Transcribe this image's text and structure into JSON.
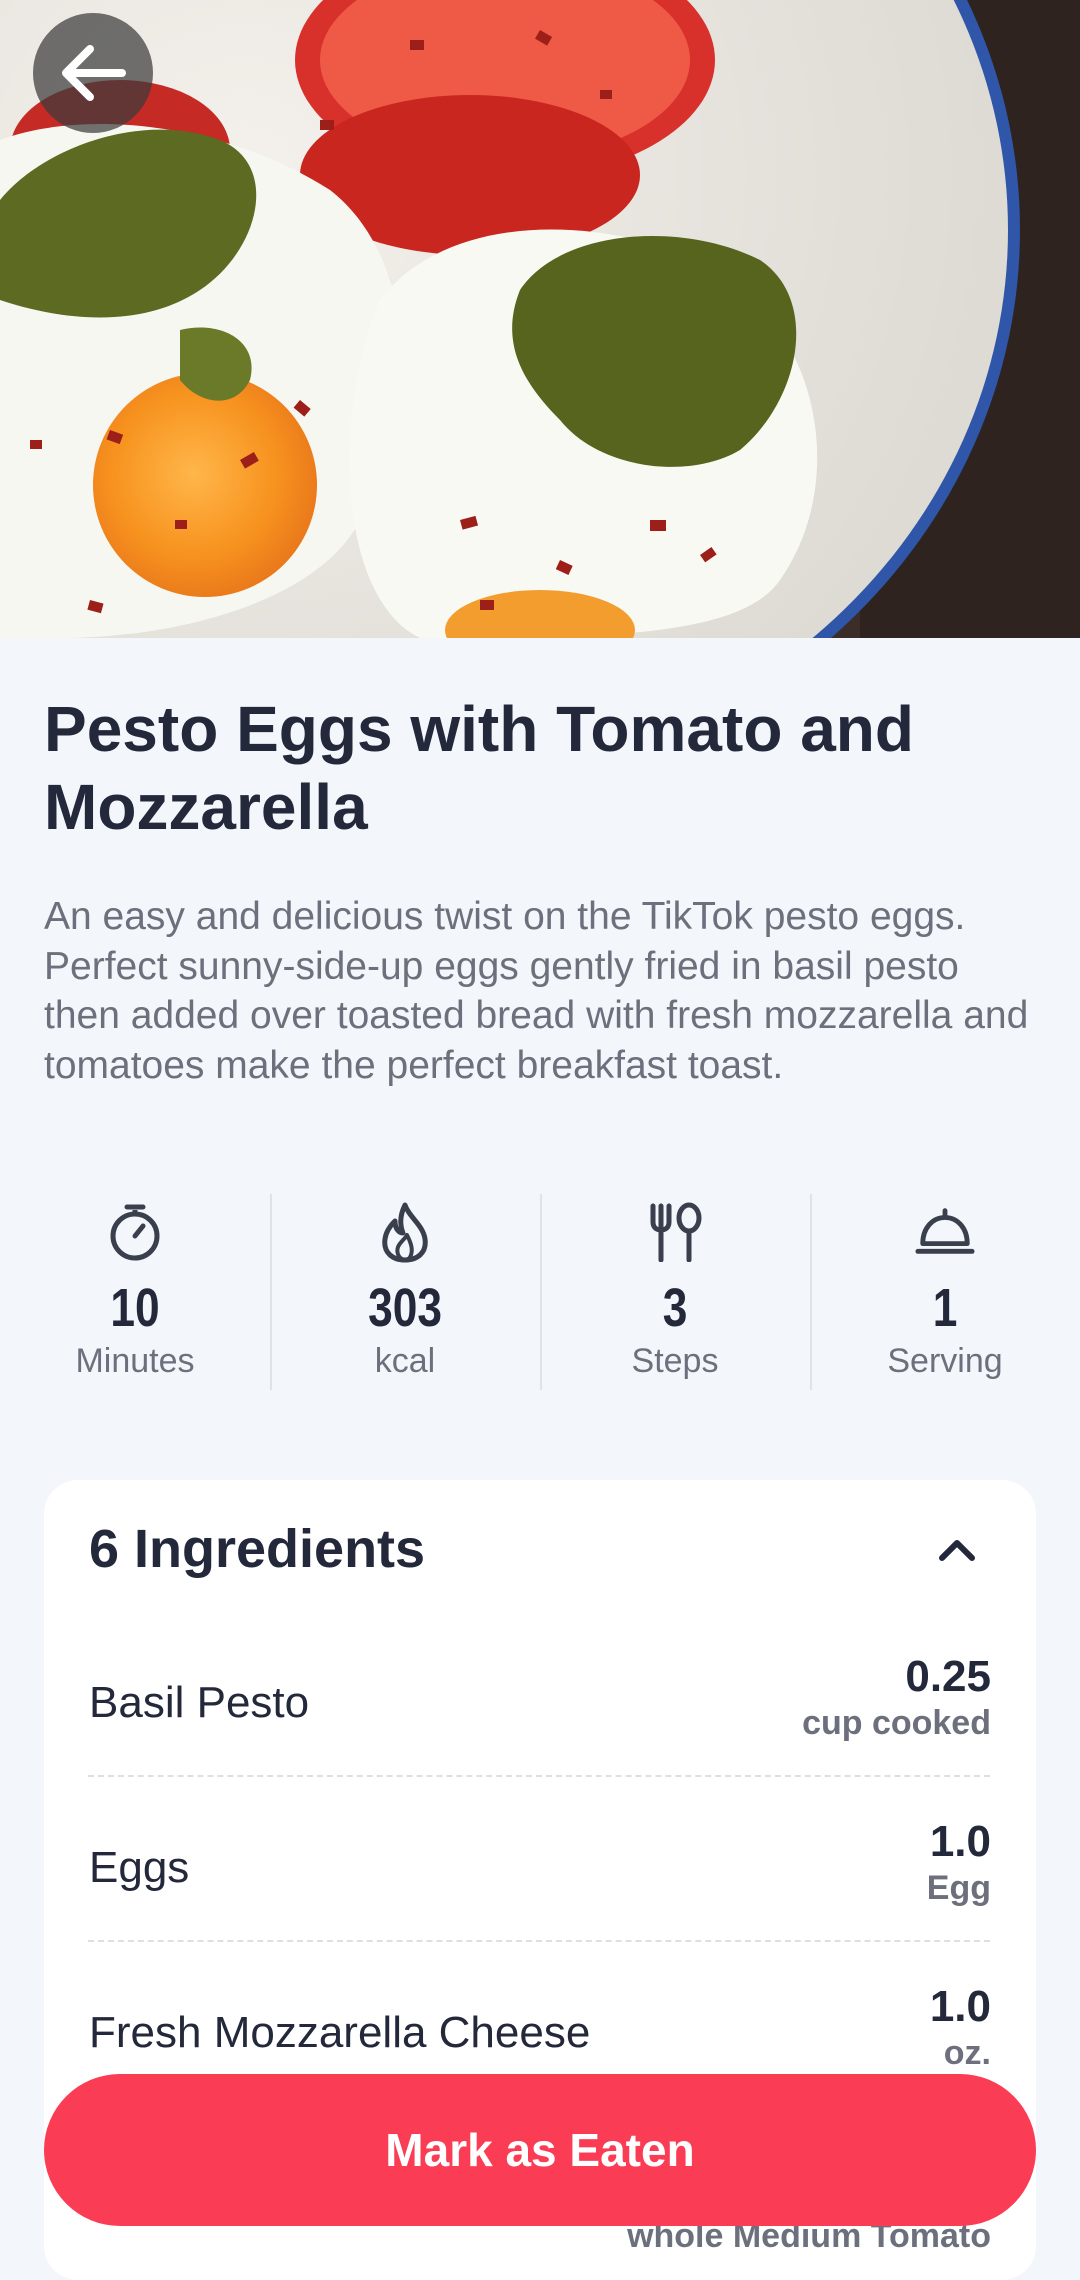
{
  "hero": {
    "icon": "food-photo-pesto-eggs",
    "back_icon": "arrow-left-icon"
  },
  "recipe": {
    "title": "Pesto Eggs with Tomato and Mozzarella",
    "description": "An easy and delicious twist on the TikTok pesto eggs. Perfect sunny-side-up eggs gently fried in basil pesto then added over toasted bread with fresh mozzarella and tomatoes make the perfect breakfast toast."
  },
  "stats": [
    {
      "icon": "stopwatch-icon",
      "value": "10",
      "label": "Minutes"
    },
    {
      "icon": "flame-icon",
      "value": "303",
      "label": "kcal"
    },
    {
      "icon": "fork-spoon-icon",
      "value": "3",
      "label": "Steps"
    },
    {
      "icon": "cloche-icon",
      "value": "1",
      "label": "Serving"
    }
  ],
  "ingredients": {
    "title": "6 Ingredients",
    "toggle_icon": "chevron-up-icon",
    "items": [
      {
        "name": "Basil Pesto",
        "quantity": "0.25",
        "unit": "cup cooked"
      },
      {
        "name": "Eggs",
        "quantity": "1.0",
        "unit": "Egg"
      },
      {
        "name": "Fresh Mozzarella Cheese",
        "quantity": "1.0",
        "unit": "oz."
      },
      {
        "name": "",
        "quantity": "",
        "unit": "whole Medium Tomato"
      }
    ]
  },
  "actions": {
    "mark_eaten_label": "Mark as Eaten"
  },
  "colors": {
    "accent": "#fb3c55",
    "background": "#f3f6fa",
    "text_primary": "#23283a",
    "text_secondary": "#6c707c"
  }
}
